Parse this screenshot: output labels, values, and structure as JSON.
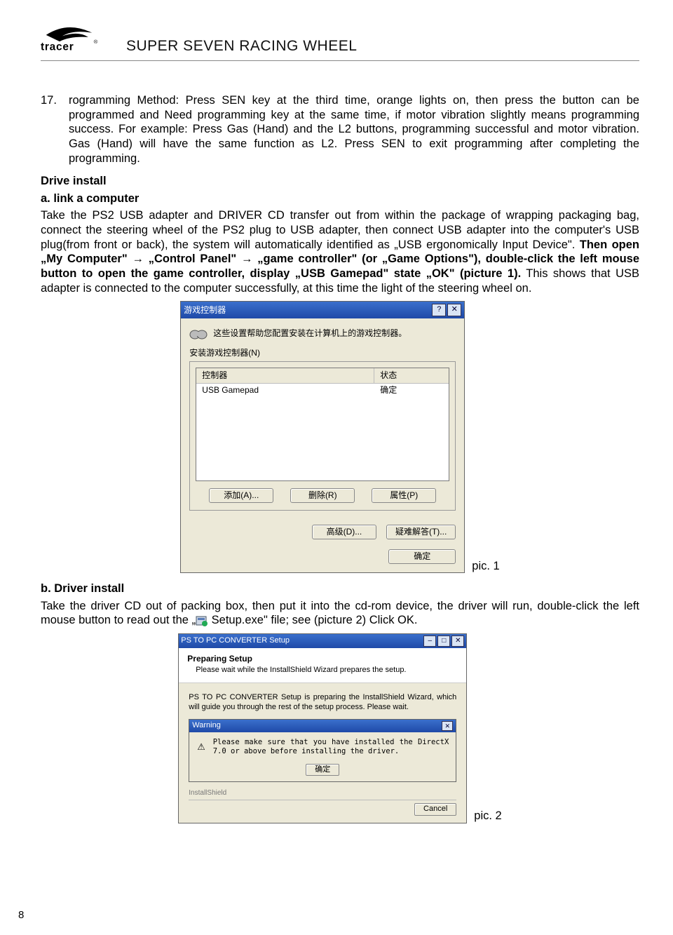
{
  "header": {
    "brand": "tracer",
    "doc_title": "SUPER SEVEN RACING WHEEL"
  },
  "item17": {
    "num": "17.",
    "text": "rogramming Method: Press SEN key at the third time, orange lights on, then press the button can be programmed and Need programming key at the same time, if motor vibration slightly means programming success. For example: Press Gas (Hand) and the L2 buttons, programming successful and motor vibration. Gas (Hand) will have the same function as L2. Press SEN to exit programming after completing the programming."
  },
  "drive_install": {
    "heading": "Drive install",
    "a_label": "a. link a computer",
    "a_text_1": "Take the PS2 USB adapter and DRIVER CD transfer out from  within the package of wrapping packaging bag, connect the steering wheel of the PS2 plug to USB adapter, then connect USB adapter into the computer's USB plug(from front or back), the system will automatically identified as „USB ergonomically Input Device\". ",
    "a_bold": "Then open „My Computer\" → „Control Panel\" → „game controller\" (or „Game Options\"), double-click the left mouse button to open the game controller, display „USB Gamepad\" state „OK\" (picture 1).",
    "a_text_2": " This shows that USB adapter is connected to the computer successfully, at this time the light of the steering wheel on.",
    "b_label": "b. Driver install",
    "b_text_1": "Take the driver CD out of packing box, then put it into the cd-rom device, the driver will run, double-click the left mouse button to read out the „",
    "b_text_2": " Setup.exe\" file; see (picture 2) Click OK."
  },
  "dlg1": {
    "title": "游戏控制器",
    "help_btn": "?",
    "close_btn": "✕",
    "intro": "这些设置帮助您配置安装在计算机上的游戏控制器。",
    "group_label": "安装游戏控制器(N)",
    "col_controller": "控制器",
    "col_status": "状态",
    "row_name": "USB Gamepad",
    "row_status": "确定",
    "btn_add": "添加(A)...",
    "btn_remove": "删除(R)",
    "btn_props": "属性(P)",
    "btn_adv": "高级(D)...",
    "btn_trouble": "疑难解答(T)...",
    "btn_ok": "确定"
  },
  "pic1_caption": "pic. 1",
  "dlg2": {
    "title": "PS TO PC CONVERTER Setup",
    "head1": "Preparing Setup",
    "head2": "Please wait while the InstallShield Wizard prepares the setup.",
    "mid": "PS TO PC CONVERTER Setup is preparing the InstallShield Wizard, which will guide you through the rest of the setup process. Please wait.",
    "warn_title": "Warning",
    "warn_close": "✕",
    "warn_text": "Please make sure that you have installed the DirectX 7.0 or above before installing the driver.",
    "warn_ok": "确定",
    "installshield": "InstallShield",
    "cancel": "Cancel"
  },
  "pic2_caption": "pic. 2",
  "page_number": "8"
}
